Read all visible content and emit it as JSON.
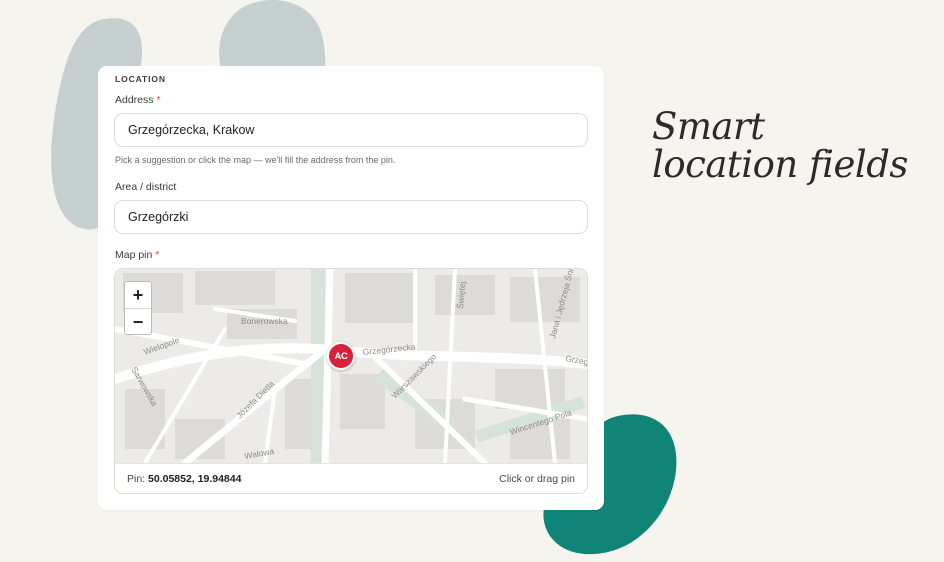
{
  "form": {
    "section_label": "LOCATION",
    "address": {
      "label": "Address",
      "required_mark": "*",
      "value": "Grzegórzecka, Krakow",
      "hint": "Pick a suggestion or click the map — we'll fill the address from the pin."
    },
    "area": {
      "label": "Area / district",
      "value": "Grzegórzki"
    },
    "map": {
      "label": "Map pin",
      "required_mark": "*",
      "zoom_in": "+",
      "zoom_out": "−",
      "marker_text": "AC",
      "street_labels": [
        "Bonerowska",
        "Wielopole",
        "Grzegórzecka",
        "Józefa Dietla",
        "Sarwowska",
        "Warszawskiego",
        "Wincentego Pola",
        "Jana i Jędrzeja Śniadeckich",
        "Świętej",
        "Grzeg",
        "Wałowa"
      ],
      "footer_prefix": "Pin:",
      "coordinates": "50.05852, 19.94844",
      "footer_action": "Click or drag pin"
    }
  },
  "headline": {
    "line1": "Smart",
    "line2": "location fields"
  },
  "colors": {
    "background": "#f5f4ef",
    "blob_gray": "#c7d0d0",
    "blob_teal": "#118478",
    "pin_red": "#d8213d",
    "required": "#c0562c"
  }
}
